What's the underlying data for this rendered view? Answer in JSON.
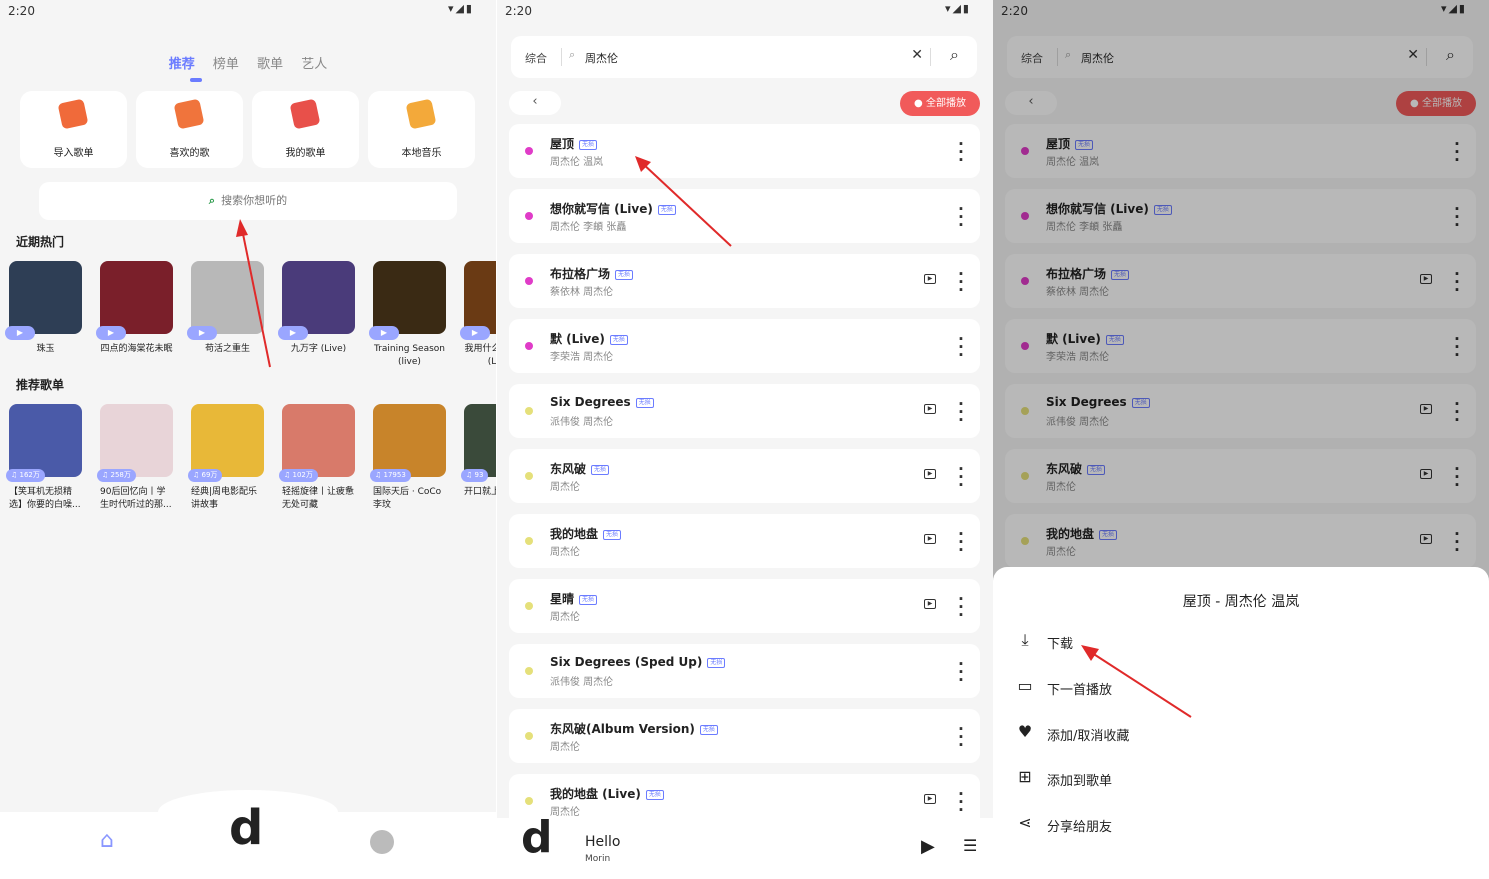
{
  "status": {
    "time": "2:20",
    "icons": "▾◢▮"
  },
  "screen1": {
    "tabs": [
      "推荐",
      "榜单",
      "歌单",
      "艺人"
    ],
    "cards": [
      {
        "label": "导入歌单",
        "color": "#f06a3a"
      },
      {
        "label": "喜欢的歌",
        "color": "#f0743c"
      },
      {
        "label": "我的歌单",
        "color": "#e8504a"
      },
      {
        "label": "本地音乐",
        "color": "#f3a93a"
      }
    ],
    "search_placeholder": "搜索你想听的",
    "hot_title": "近期热门",
    "hot": [
      {
        "label": "珠玉",
        "color": "#2e3e55"
      },
      {
        "label": "四点的海棠花未眠",
        "color": "#7a1f2a"
      },
      {
        "label": "苟活之重生",
        "color": "#b8b8b8"
      },
      {
        "label": "九万字 (Live)",
        "color": "#4a3b7a"
      },
      {
        "label": "Training Season (live)",
        "color": "#3a2a14"
      },
      {
        "label": "我用什么把你留住 (Live)",
        "color": "#6a3a14"
      }
    ],
    "rec_title": "推荐歌单",
    "rec": [
      {
        "count": "162万",
        "label": "【笑耳机无损精选】你要的白噪...",
        "color": "#4a5aa8"
      },
      {
        "count": "258万",
        "label": "90后回忆向丨学生时代听过的那...",
        "color": "#e8d4d8"
      },
      {
        "count": "69万",
        "label": "经典|周电影配乐讲故事",
        "color": "#e8b838"
      },
      {
        "count": "102万",
        "label": "轻摇旋律丨让疲惫无处可藏",
        "color": "#d87a6a"
      },
      {
        "count": "17953",
        "label": "国际天后 · CoCo 李玟",
        "color": "#c8842a"
      },
      {
        "count": "93",
        "label": "开口就上欧美",
        "color": "#3a4a3a"
      }
    ]
  },
  "search": {
    "category": "综合",
    "query": "周杰伦",
    "play_all": "全部播放",
    "badge": "无损"
  },
  "songs": [
    {
      "title": "屋顶",
      "artist": "周杰伦 温岚",
      "dot": "#e03cc8",
      "mv": false
    },
    {
      "title": "想你就写信 (Live)",
      "artist": "周杰伦 李頔 张矗",
      "dot": "#e03cc8",
      "mv": false
    },
    {
      "title": "布拉格广场",
      "artist": "蔡依林 周杰伦",
      "dot": "#e03cc8",
      "mv": true
    },
    {
      "title": "默 (Live)",
      "artist": "李荣浩 周杰伦",
      "dot": "#e03cc8",
      "mv": false
    },
    {
      "title": "Six Degrees",
      "artist": "派伟俊 周杰伦",
      "dot": "#e5e07a",
      "mv": true
    },
    {
      "title": "东风破",
      "artist": "周杰伦",
      "dot": "#e5e07a",
      "mv": true
    },
    {
      "title": "我的地盘",
      "artist": "周杰伦",
      "dot": "#e5e07a",
      "mv": true
    },
    {
      "title": "星晴",
      "artist": "周杰伦",
      "dot": "#e5e07a",
      "mv": true
    },
    {
      "title": "Six Degrees (Sped Up)",
      "artist": "派伟俊 周杰伦",
      "dot": "#e5e07a",
      "mv": false
    },
    {
      "title": "东风破(Album Version)",
      "artist": "周杰伦",
      "dot": "#e5e07a",
      "mv": false
    },
    {
      "title": "我的地盘 (Live)",
      "artist": "周杰伦",
      "dot": "#e5e07a",
      "mv": true
    }
  ],
  "player": {
    "title": "Hello",
    "artist": "Morin"
  },
  "sheet": {
    "title": "屋顶 - 周杰伦 温岚",
    "items": [
      {
        "label": "下载",
        "icon": "download-icon",
        "glyph": "⤓"
      },
      {
        "label": "下一首播放",
        "icon": "airplay-icon",
        "glyph": "▭"
      },
      {
        "label": "添加/取消收藏",
        "icon": "heart-icon",
        "glyph": "♥"
      },
      {
        "label": "添加到歌单",
        "icon": "add-box-icon",
        "glyph": "⊞"
      },
      {
        "label": "分享给朋友",
        "icon": "share-icon",
        "glyph": "⋖"
      }
    ]
  },
  "colors": {
    "accent": "#6b7cff",
    "play_all": "#f15a5a",
    "arrow": "#e02a2a"
  }
}
